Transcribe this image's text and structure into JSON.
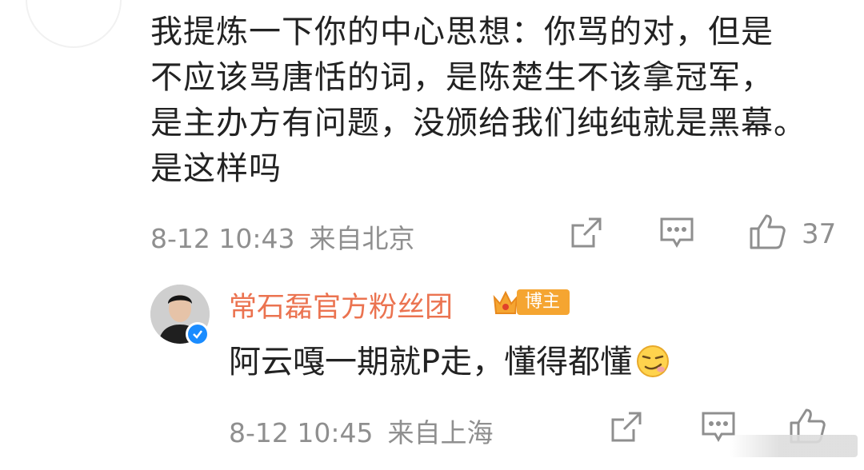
{
  "comment": {
    "lines": [
      "我提炼一下你的中心思想：你骂的对，但是",
      "不应该骂唐恬的词，是陈楚生不该拿冠军，",
      "是主办方有问题，没颁给我们纯纯就是黑幕。",
      "是这样吗"
    ],
    "time": "8-12 10:43",
    "location": "来自北京",
    "like_count": "37"
  },
  "reply": {
    "author": "常石磊官方粉丝团",
    "badge": "博主",
    "text": "阿云嘎一期就P走，懂得都懂",
    "emoji_icon": "smirk-emoji-icon",
    "time": "8-12 10:45",
    "location": "来自上海"
  },
  "colors": {
    "author_name": "#eb7350",
    "badge_bg": "#f5a531",
    "meta_text": "#8f8f8f",
    "verify_blue": "#1a8cff"
  }
}
